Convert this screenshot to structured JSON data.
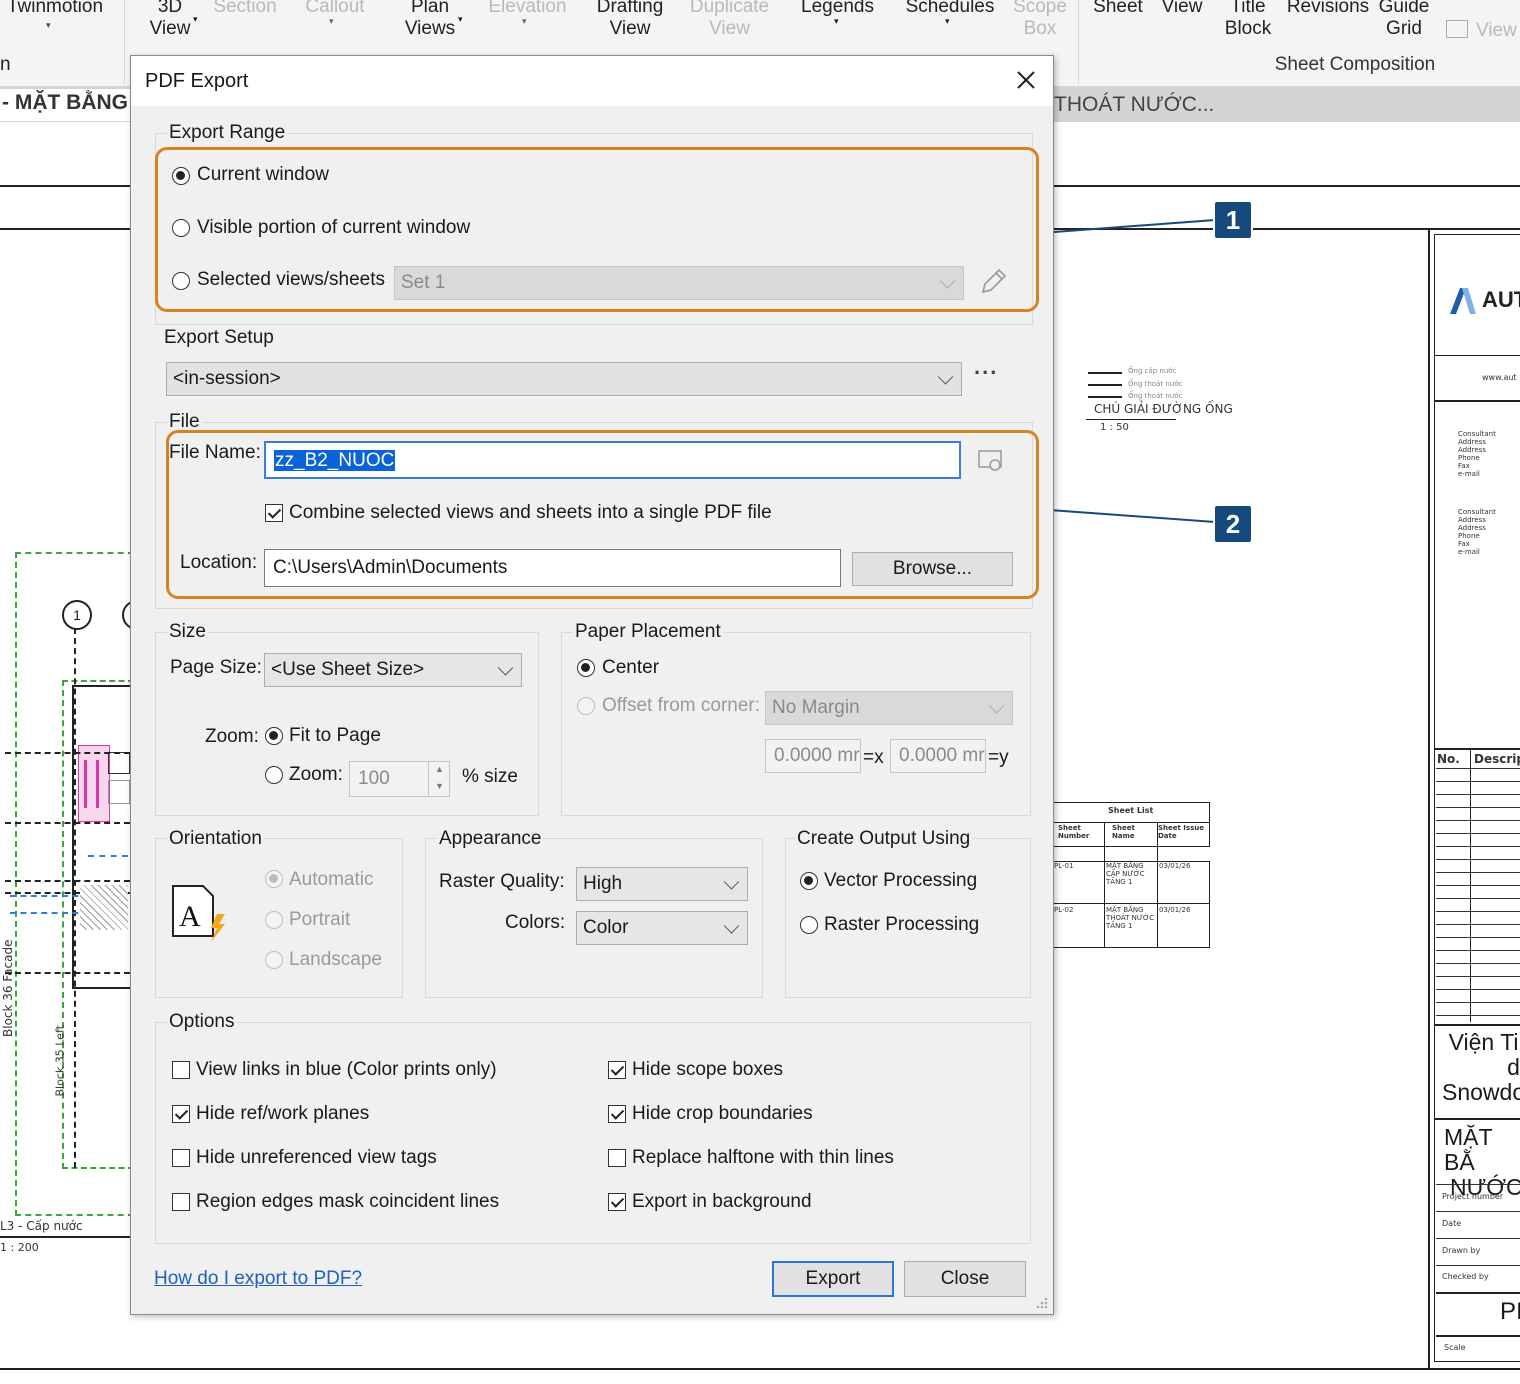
{
  "ribbon": {
    "items": [
      {
        "label": "Twinmotion",
        "disabled": false
      },
      {
        "label": "3D\nView",
        "disabled": false
      },
      {
        "label": "Section",
        "disabled": true
      },
      {
        "label": "Callout",
        "disabled": true
      },
      {
        "label": "Plan\nViews",
        "disabled": false
      },
      {
        "label": "Elevation",
        "disabled": true
      },
      {
        "label": "Drafting\nView",
        "disabled": false
      },
      {
        "label": "Duplicate\nView",
        "disabled": true
      },
      {
        "label": "Legends",
        "disabled": false
      },
      {
        "label": "Schedules",
        "disabled": false
      },
      {
        "label": "Scope\nBox",
        "disabled": true
      },
      {
        "label": "Sheet",
        "disabled": false
      },
      {
        "label": "View",
        "disabled": false
      },
      {
        "label": "Title\nBlock",
        "disabled": false
      },
      {
        "label": "Revisions",
        "disabled": false
      },
      {
        "label": "Guide\nGrid",
        "disabled": false
      },
      {
        "label": "View",
        "disabled": true
      }
    ],
    "panel_label": "Sheet Composition",
    "left_fragment": "n"
  },
  "view_tabs": {
    "left": "- MẶT BẰNG (",
    "right": "THOÁT NƯỚC..."
  },
  "drawing": {
    "legend_title": "CHÚ GIẢI ĐƯỜNG ỐNG",
    "legend_scale": "1 : 50",
    "legend_items": [
      "Ống cấp nước",
      "Ống thoát nước",
      "Ống thoát nước"
    ],
    "left_view_label": "L3 - Cấp nước",
    "left_view_scale": "1 : 200",
    "facade_label": "Block 36 Facade",
    "block_label": "Block 35 Left",
    "grid_bubble": "1",
    "logo_text": "AUT",
    "website": "www.aut",
    "consultant_block": [
      "Consultant",
      "Address",
      "Address",
      "Phone",
      "Fax",
      "e-mail"
    ],
    "revision_headers": [
      "No.",
      "Descrip"
    ],
    "company_lines": [
      "Viện Ti",
      "d",
      "Snowdo"
    ],
    "sheet_title": [
      "MẶT BẰ",
      "NƯỚC"
    ],
    "tb_fields": [
      "Project number",
      "Date",
      "Drawn by",
      "Checked by"
    ],
    "sheet_number_fragment": "PI",
    "scale_label": "Scale",
    "sheet_list": {
      "title": "Sheet List",
      "headers": [
        "Sheet Number",
        "Sheet Name",
        "Sheet Issue Date"
      ],
      "rows": [
        {
          "number": "PL-01",
          "name": "MẶT BẰNG CẤP NƯỚC TẦNG 1",
          "date": "03/01/26"
        },
        {
          "number": "PL-02",
          "name": "MẶT BẰNG THOÁT NƯỚC TẦNG 1",
          "date": "03/01/26"
        }
      ]
    }
  },
  "dialog": {
    "title": "PDF Export",
    "export_range": {
      "label": "Export Range",
      "options": [
        "Current window",
        "Visible portion of current window",
        "Selected views/sheets"
      ],
      "selected": 0,
      "set_value": "Set 1"
    },
    "export_setup": {
      "label": "Export Setup",
      "value": "<in-session>",
      "more": "..."
    },
    "file": {
      "label": "File",
      "file_name_label": "File Name:",
      "file_name_value": "zz_B2_NUOC",
      "combine_label": "Combine selected views and sheets into a single PDF file",
      "combine_checked": true,
      "location_label": "Location:",
      "location_value": "C:\\Users\\Admin\\Documents",
      "browse_label": "Browse..."
    },
    "size": {
      "label": "Size",
      "page_size_label": "Page Size:",
      "page_size_value": "<Use Sheet Size>",
      "zoom_label": "Zoom:",
      "fit_label": "Fit to Page",
      "zoom2_label": "Zoom:",
      "zoom_value": "100",
      "percent_label": "% size"
    },
    "paper_placement": {
      "label": "Paper Placement",
      "center_label": "Center",
      "offset_label": "Offset from corner:",
      "offset_value": "No Margin",
      "x_value": "0.0000 mr",
      "x_suffix": "=x",
      "y_value": "0.0000 mr",
      "y_suffix": "=y"
    },
    "orientation": {
      "label": "Orientation",
      "options": [
        "Automatic",
        "Portrait",
        "Landscape"
      ]
    },
    "appearance": {
      "label": "Appearance",
      "raster_label": "Raster Quality:",
      "raster_value": "High",
      "colors_label": "Colors:",
      "colors_value": "Color"
    },
    "output": {
      "label": "Create Output Using",
      "options": [
        "Vector Processing",
        "Raster Processing"
      ],
      "selected": 0
    },
    "options": {
      "label": "Options",
      "left": [
        {
          "label": "View links in blue (Color prints only)",
          "checked": false
        },
        {
          "label": "Hide ref/work planes",
          "checked": true
        },
        {
          "label": "Hide unreferenced view tags",
          "checked": false
        },
        {
          "label": "Region edges mask coincident lines",
          "checked": false
        }
      ],
      "right": [
        {
          "label": "Hide scope boxes",
          "checked": true
        },
        {
          "label": "Hide crop boundaries",
          "checked": true
        },
        {
          "label": "Replace halftone with thin lines",
          "checked": false
        },
        {
          "label": "Export in background",
          "checked": true
        }
      ]
    },
    "help_link": "How do I export to PDF?",
    "export_button": "Export",
    "close_button": "Close"
  },
  "annotations": {
    "callouts": [
      "1",
      "2"
    ],
    "box_color": "#d58425",
    "callout_color": "#174a7c"
  },
  "colors": {
    "link": "#1f5fbf",
    "selection": "#0a64d8",
    "default_button_border": "#2a78d6"
  }
}
